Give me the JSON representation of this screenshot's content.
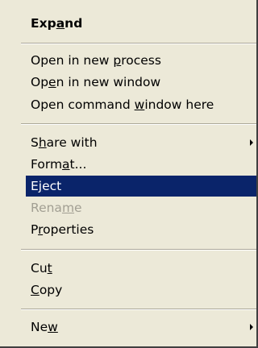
{
  "menu": {
    "items": [
      {
        "label": "Expand",
        "mnemonic_index": 3,
        "bold": true,
        "selected": false,
        "disabled": false,
        "submenu": false
      },
      {
        "label": "Open in new process",
        "mnemonic_index": 12,
        "bold": false,
        "selected": false,
        "disabled": false,
        "submenu": false
      },
      {
        "label": "Open in new window",
        "mnemonic_index": 2,
        "bold": false,
        "selected": false,
        "disabled": false,
        "submenu": false
      },
      {
        "label": "Open command window here",
        "mnemonic_index": 13,
        "bold": false,
        "selected": false,
        "disabled": false,
        "submenu": false
      },
      {
        "label": "Share with",
        "mnemonic_index": 1,
        "bold": false,
        "selected": false,
        "disabled": false,
        "submenu": true
      },
      {
        "label": "Format...",
        "mnemonic_index": 4,
        "bold": false,
        "selected": false,
        "disabled": false,
        "submenu": false
      },
      {
        "label": "Eject",
        "mnemonic_index": 1,
        "bold": false,
        "selected": true,
        "disabled": false,
        "submenu": false
      },
      {
        "label": "Rename",
        "mnemonic_index": 4,
        "bold": false,
        "selected": false,
        "disabled": true,
        "submenu": false
      },
      {
        "label": "Properties",
        "mnemonic_index": 1,
        "bold": false,
        "selected": false,
        "disabled": false,
        "submenu": false
      },
      {
        "label": "Cut",
        "mnemonic_index": 2,
        "bold": false,
        "selected": false,
        "disabled": false,
        "submenu": false
      },
      {
        "label": "Copy",
        "mnemonic_index": 0,
        "bold": false,
        "selected": false,
        "disabled": false,
        "submenu": false
      },
      {
        "label": "New",
        "mnemonic_index": 2,
        "bold": false,
        "selected": false,
        "disabled": false,
        "submenu": true
      }
    ],
    "colors": {
      "menu_background": "#ece9d8",
      "highlight_background": "#0a246a",
      "highlight_text": "#ffffff",
      "disabled_text": "#a29f93"
    }
  }
}
